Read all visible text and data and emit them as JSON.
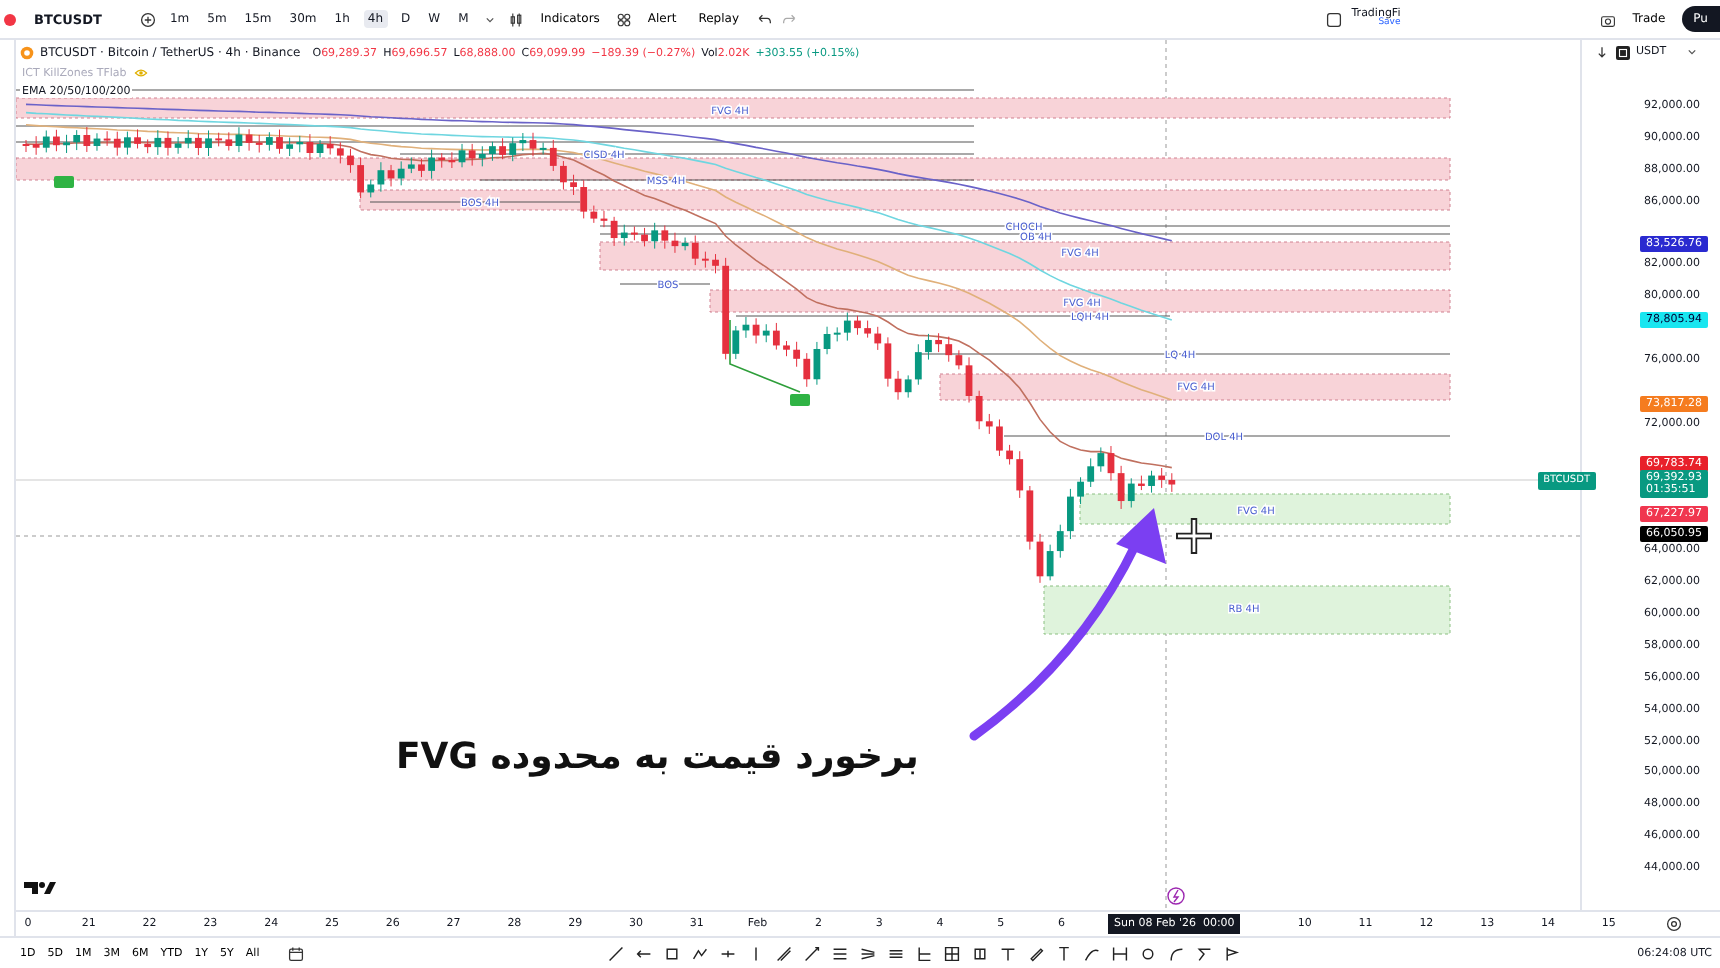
{
  "toolbar": {
    "symbol": "BTCUSDT",
    "intervals": [
      {
        "label": "1m",
        "selected": false
      },
      {
        "label": "5m",
        "selected": false
      },
      {
        "label": "15m",
        "selected": false
      },
      {
        "label": "30m",
        "selected": false
      },
      {
        "label": "1h",
        "selected": false
      },
      {
        "label": "4h",
        "selected": true
      },
      {
        "label": "D",
        "selected": false
      },
      {
        "label": "W",
        "selected": false
      },
      {
        "label": "M",
        "selected": false
      }
    ],
    "indicators": "Indicators",
    "alert": "Alert",
    "replay": "Replay",
    "layout_name": "TradingFi",
    "save": "Save",
    "trade": "Trade",
    "publish": "Pu"
  },
  "legend": {
    "title": "BTCUSDT · Bitcoin / TetherUS · 4h · Binance",
    "ohlc": [
      {
        "letter": "O",
        "value": "69,289.37"
      },
      {
        "letter": "H",
        "value": "69,696.57"
      },
      {
        "letter": "L",
        "value": "68,888.00"
      },
      {
        "letter": "C",
        "value": "69,099.99"
      }
    ],
    "change": "−189.39 (−0.27%)",
    "volume_label": "Vol",
    "volume": "2.02K",
    "volume_change": "+303.55 (+0.15%)",
    "indicators": [
      {
        "name": "ICT KillZones TFlab",
        "visible": false
      },
      {
        "name": "EMA 20/50/100/200",
        "visible": true
      }
    ]
  },
  "currency": "USDT",
  "chart": {
    "annotation": "برخورد قیمت به محدوده FVG",
    "levels": [
      {
        "label": "FVG 4H",
        "kind": "bearish_gap"
      },
      {
        "label": "CISD 4H",
        "kind": "level"
      },
      {
        "label": "MSS 4H",
        "kind": "level"
      },
      {
        "label": "BOS 4H",
        "kind": "level"
      },
      {
        "label": "CHOCH",
        "kind": "level"
      },
      {
        "label": "OB 4H",
        "kind": "level"
      },
      {
        "label": "FVG 4H",
        "kind": "bearish_gap"
      },
      {
        "label": "BOS",
        "kind": "level"
      },
      {
        "label": "FVG 4H",
        "kind": "bearish_gap"
      },
      {
        "label": "LQH 4H",
        "kind": "level"
      },
      {
        "label": "LQ 4H",
        "kind": "level"
      },
      {
        "label": "FVG 4H",
        "kind": "bearish_gap"
      },
      {
        "label": "DOL 4H",
        "kind": "level"
      },
      {
        "label": "FVG 4H",
        "kind": "bullish_gap"
      },
      {
        "label": "RB 4H",
        "kind": "bullish_gap"
      }
    ]
  },
  "price_scale": [
    "92,000.00",
    "90,000.00",
    "88,000.00",
    "86,000.00",
    "82,000.00",
    "80,000.00",
    "76,000.00",
    "72,000.00",
    "64,000.00",
    "62,000.00",
    "60,000.00",
    "58,000.00",
    "56,000.00",
    "54,000.00",
    "52,000.00",
    "50,000.00",
    "48,000.00",
    "46,000.00",
    "44,000.00"
  ],
  "price_tags": [
    {
      "value": "83,526.76",
      "color": "#2a2ad0"
    },
    {
      "value": "78,805.94",
      "color": "#19e6f0"
    },
    {
      "value": "73,817.28",
      "color": "#f57c1f"
    },
    {
      "value": "69,783.74",
      "color": "#e8202a"
    },
    {
      "value": "67,227.97",
      "color": "#f0364f"
    },
    {
      "value": "66,050.95",
      "color": "#000000"
    }
  ],
  "last_price": {
    "symbol": "BTCUSDT",
    "value": "69,392.93",
    "countdown": "01:35:51",
    "color": "#089981"
  },
  "time_scale": {
    "labels": [
      "0",
      "21",
      "22",
      "23",
      "24",
      "25",
      "26",
      "27",
      "28",
      "29",
      "30",
      "31",
      "Feb",
      "2",
      "3",
      "4",
      "5",
      "6",
      "10",
      "11",
      "12",
      "13",
      "14",
      "15"
    ],
    "crosshair": "Sun 08 Feb '26  00:00"
  },
  "bottom_bar": {
    "ranges": [
      "1D",
      "5D",
      "1M",
      "3M",
      "6M",
      "YTD",
      "1Y",
      "5Y",
      "All"
    ],
    "clock": "06:24:08 UTC"
  }
}
